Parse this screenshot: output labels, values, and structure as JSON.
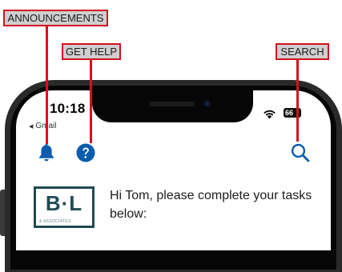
{
  "status_bar": {
    "time": "10:18",
    "back_app": "Gmail",
    "battery": "66"
  },
  "app": {
    "greeting": "Hi Tom, please complete your tasks below:",
    "logo": {
      "main_text": "B·L",
      "sub_text": "& ASSOCIATES"
    },
    "icons": {
      "announcements": "bell-icon",
      "help": "question-circle-icon",
      "search": "search-icon"
    }
  },
  "annotations": {
    "announcements": "ANNOUNCEMENTS",
    "help": "GET HELP",
    "search": "SEARCH"
  },
  "colors": {
    "accent_blue": "#0b5cad",
    "annotation_red": "#d4111f",
    "logo_teal": "#1f4b52"
  }
}
